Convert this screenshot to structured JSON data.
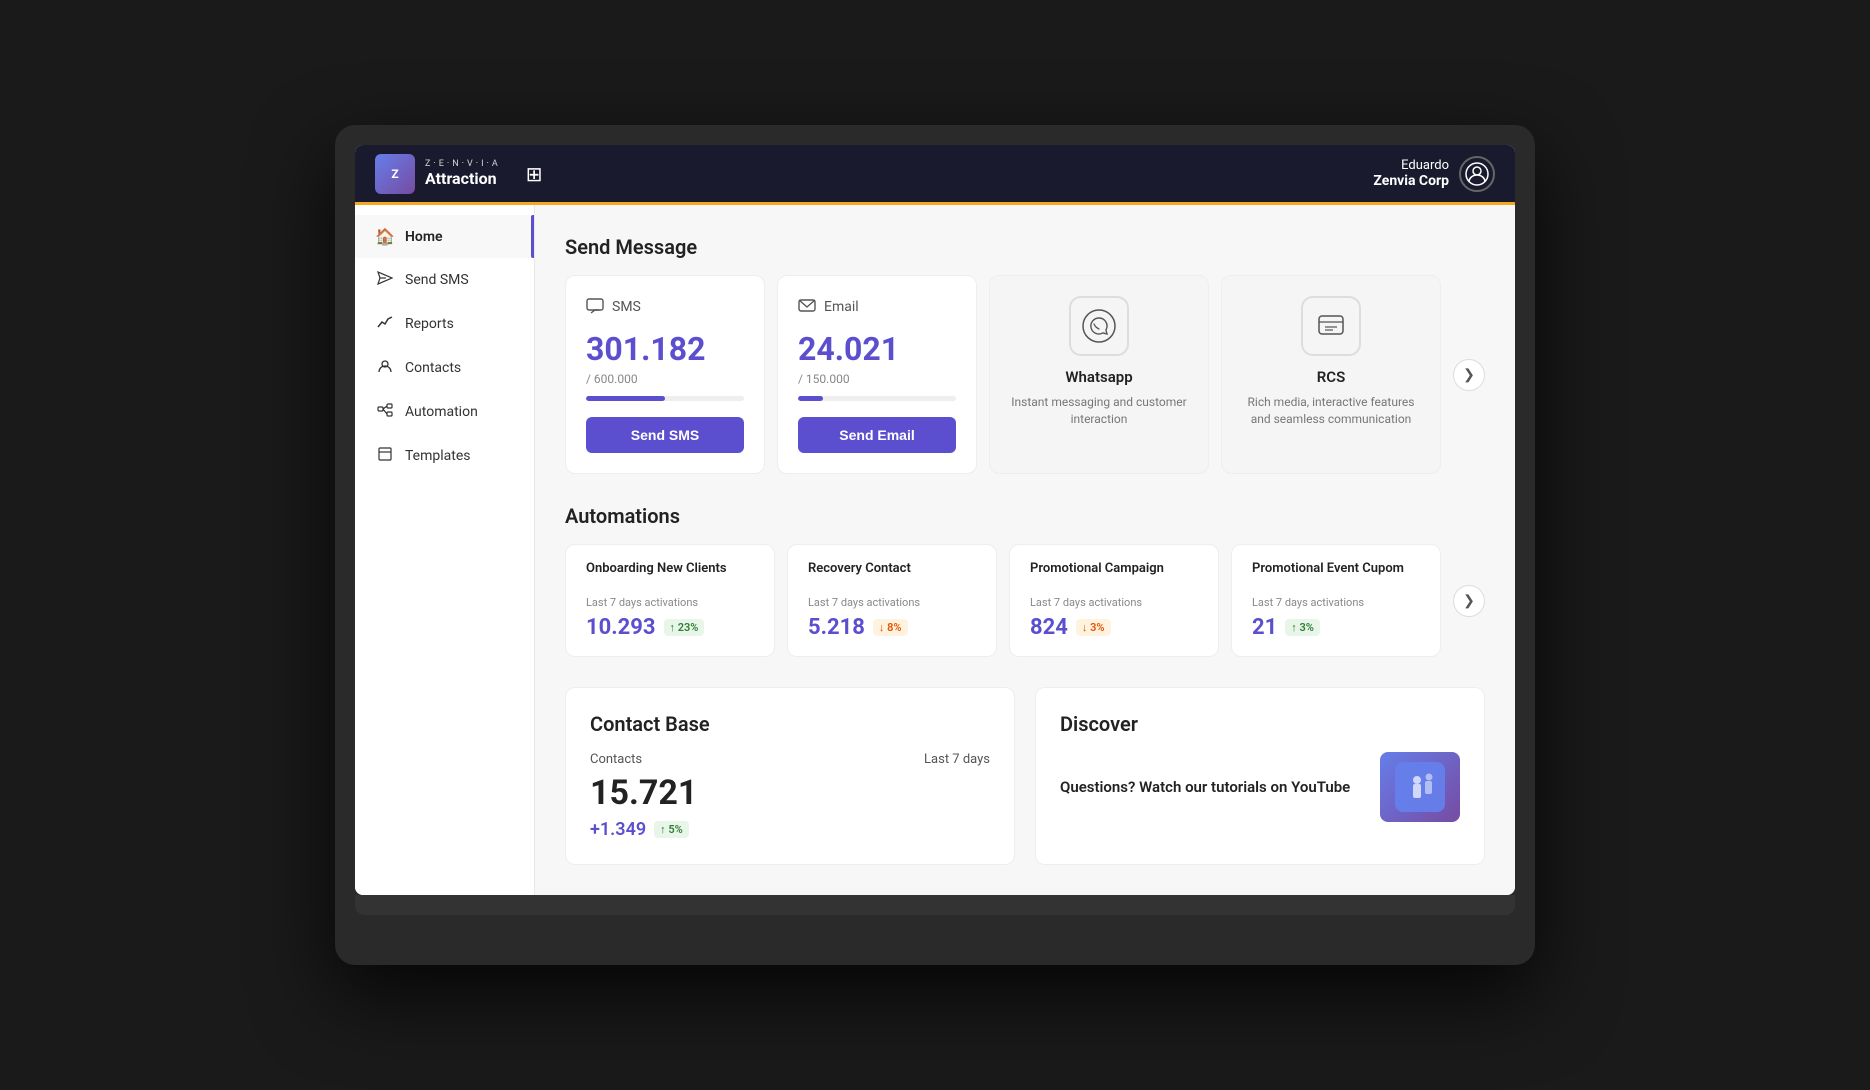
{
  "header": {
    "logo_brand": "Z·E·N·V·I·A",
    "logo_product": "Attraction",
    "grid_icon": "⊞",
    "user_first": "Eduardo",
    "user_company": "Zenvia Corp",
    "user_icon": "👤"
  },
  "sidebar": {
    "items": [
      {
        "id": "home",
        "label": "Home",
        "icon": "🏠",
        "active": true
      },
      {
        "id": "send-sms",
        "label": "Send SMS",
        "icon": "✉",
        "active": false
      },
      {
        "id": "reports",
        "label": "Reports",
        "icon": "📈",
        "active": false
      },
      {
        "id": "contacts",
        "label": "Contacts",
        "icon": "👤",
        "active": false
      },
      {
        "id": "automation",
        "label": "Automation",
        "icon": "⚙",
        "active": false
      },
      {
        "id": "templates",
        "label": "Templates",
        "icon": "📄",
        "active": false
      }
    ]
  },
  "send_message": {
    "section_title": "Send Message",
    "sms_card": {
      "icon": "💬",
      "title": "SMS",
      "value": "301.182",
      "limit": "/ 600.000",
      "progress": 50,
      "button_label": "Send SMS"
    },
    "email_card": {
      "icon": "✉",
      "title": "Email",
      "value": "24.021",
      "limit": "/ 150.000",
      "progress": 16,
      "button_label": "Send Email"
    },
    "whatsapp_card": {
      "icon": "📱",
      "title": "Whatsapp",
      "desc": "Instant messaging and customer interaction"
    },
    "rcs_card": {
      "icon": "💬",
      "title": "RCS",
      "desc": "Rich media, interactive features and seamless communication"
    },
    "nav_icon": "❯"
  },
  "automations": {
    "section_title": "Automations",
    "cards": [
      {
        "name": "Onboarding New Clients",
        "label": "Last 7 days activations",
        "value": "10.293",
        "badge": "↑ 23%",
        "badge_type": "up"
      },
      {
        "name": "Recovery Contact",
        "label": "Last 7 days activations",
        "value": "5.218",
        "badge": "↓ 8%",
        "badge_type": "down"
      },
      {
        "name": "Promotional Campaign",
        "label": "Last 7 days activations",
        "value": "824",
        "badge": "↓ 3%",
        "badge_type": "down"
      },
      {
        "name": "Promotional Event Cupom",
        "label": "Last 7 days activations",
        "value": "21",
        "badge": "↑ 3%",
        "badge_type": "up"
      }
    ],
    "nav_icon": "❯"
  },
  "contact_base": {
    "section_title": "Contact Base",
    "label": "Contacts",
    "last7": "Last 7 days",
    "value": "15.721",
    "delta": "+1.349",
    "delta_pct": "↑ 5%",
    "delta_pct_type": "up"
  },
  "discover": {
    "section_title": "Discover",
    "text": "Questions? Watch our tutorials on YouTube",
    "img_icon": "🧗"
  }
}
